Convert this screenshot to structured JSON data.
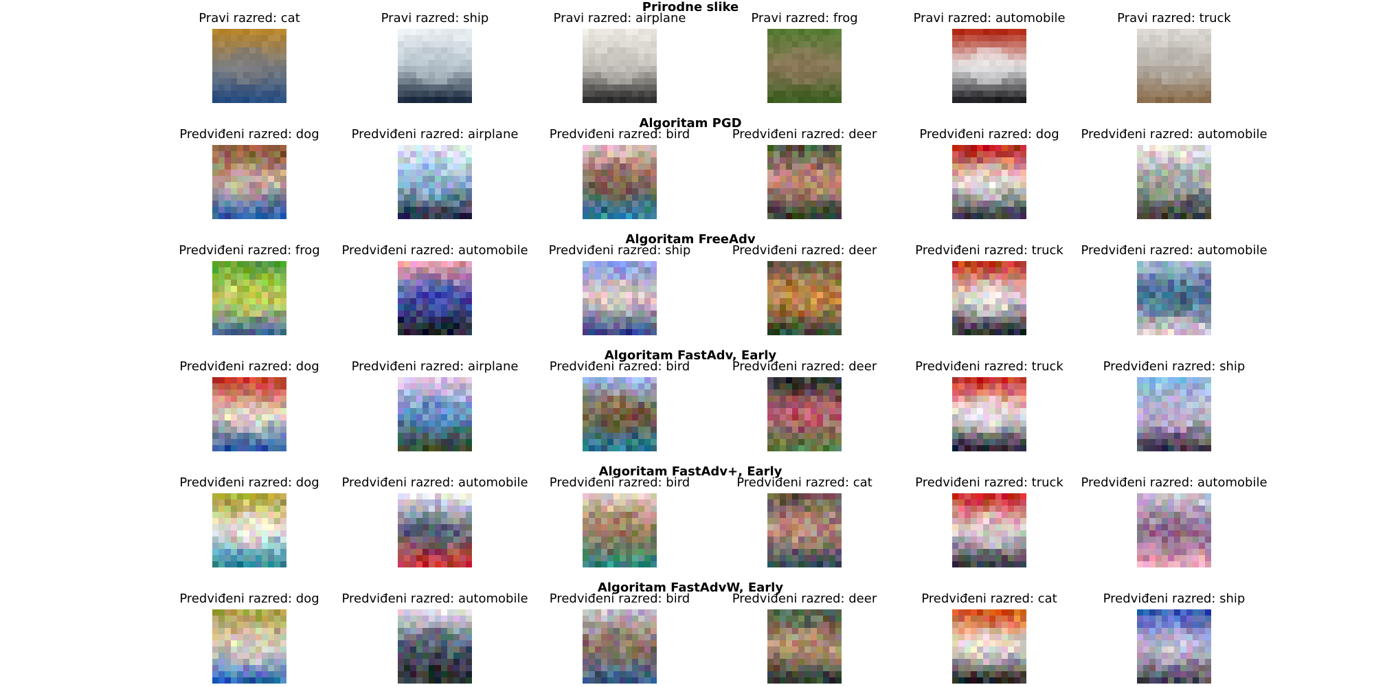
{
  "figure": {
    "rows": [
      {
        "title": "Prirodne slike",
        "labels": [
          "Pravi razred: cat",
          "Pravi razred: ship",
          "Pravi razred: airplane",
          "Pravi razred: frog",
          "Pravi razred: automobile",
          "Pravi razred: truck"
        ],
        "images": [
          {
            "subject": "cat",
            "colors": [
              "#b8862e",
              "#7d7d7f",
              "#2a4f82"
            ]
          },
          {
            "subject": "ship",
            "colors": [
              "#e8eef2",
              "#b8c4cc",
              "#1d2c40"
            ]
          },
          {
            "subject": "airplane",
            "colors": [
              "#eae6e0",
              "#c5c1bb",
              "#2e2e2e"
            ]
          },
          {
            "subject": "frog",
            "colors": [
              "#567a33",
              "#8c7859",
              "#3f5e22"
            ]
          },
          {
            "subject": "automobile",
            "colors": [
              "#b32a17",
              "#e8e8ea",
              "#1e1e22"
            ]
          },
          {
            "subject": "truck",
            "colors": [
              "#d9d5d0",
              "#b8b2aa",
              "#8a6d4e"
            ]
          }
        ]
      },
      {
        "title": "Algoritam PGD",
        "labels": [
          "Predviđeni razred: dog",
          "Predviđeni razred: airplane",
          "Predviđeni razred: bird",
          "Predviđeni razred: deer",
          "Predviđeni razred: dog",
          "Predviđeni razred: automobile"
        ],
        "images": [
          {
            "subject": "dog",
            "colors": [
              "#8c5a3c",
              "#c9b09c",
              "#2f5fa8"
            ]
          },
          {
            "subject": "airplane",
            "colors": [
              "#e4eaf6",
              "#8ab2d8",
              "#2f3346"
            ]
          },
          {
            "subject": "bird",
            "colors": [
              "#d9b8b8",
              "#7f5f4a",
              "#2e7f9a"
            ]
          },
          {
            "subject": "deer",
            "colors": [
              "#4f5d43",
              "#c9917f",
              "#2e3a2a"
            ]
          },
          {
            "subject": "dog",
            "colors": [
              "#b82a1e",
              "#e3d8d0",
              "#3a3a4a"
            ]
          },
          {
            "subject": "automobile",
            "colors": [
              "#e6e2e8",
              "#9ea6a0",
              "#3b3b3b"
            ]
          }
        ]
      },
      {
        "title": "Algoritam FreeAdv",
        "labels": [
          "Predviđeni razred: frog",
          "Predviđeni razred: automobile",
          "Predviđeni razred: ship",
          "Predviđeni razred: deer",
          "Predviđeni razred: truck",
          "Predviđeni razred: automobile"
        ],
        "images": [
          {
            "subject": "frog",
            "colors": [
              "#5fa83a",
              "#c4d25a",
              "#4f6a9a"
            ]
          },
          {
            "subject": "automobile",
            "colors": [
              "#e2a0b0",
              "#3f4fa8",
              "#1e2030"
            ]
          },
          {
            "subject": "ship",
            "colors": [
              "#8aa0e0",
              "#d8c8c0",
              "#3f4f8a"
            ]
          },
          {
            "subject": "deer",
            "colors": [
              "#6a5a4a",
              "#c98a4a",
              "#3b4a3a"
            ]
          },
          {
            "subject": "truck",
            "colors": [
              "#c43a2a",
              "#e8e2e0",
              "#2a2a3a"
            ]
          },
          {
            "subject": "automobile",
            "colors": [
              "#9ab0c8",
              "#3f6a8a",
              "#d8c4cf"
            ]
          }
        ]
      },
      {
        "title": "Algoritam FastAdv, Early",
        "labels": [
          "Predviđeni razred: dog",
          "Predviđeni razred: airplane",
          "Predviđeni razred: bird",
          "Predviđeni razred: deer",
          "Predviđeni razred: truck",
          "Predviđeni razred: ship"
        ],
        "images": [
          {
            "subject": "dog",
            "colors": [
              "#c83a2a",
              "#e8d8c8",
              "#2f5fa0"
            ]
          },
          {
            "subject": "airplane",
            "colors": [
              "#e6c8e8",
              "#5f8ac8",
              "#2f4a2a"
            ]
          },
          {
            "subject": "bird",
            "colors": [
              "#9ab0e0",
              "#7a5f3a",
              "#2f7a9a"
            ]
          },
          {
            "subject": "deer",
            "colors": [
              "#2f3a34",
              "#b85a6a",
              "#5a7a4a"
            ]
          },
          {
            "subject": "truck",
            "colors": [
              "#c8302a",
              "#ece6e6",
              "#2a2a38"
            ]
          },
          {
            "subject": "ship",
            "colors": [
              "#8ab8e0",
              "#c8b8d8",
              "#3f3a4a"
            ]
          }
        ]
      },
      {
        "title": "Algoritam FastAdv+, Early",
        "labels": [
          "Predviđeni razred: dog",
          "Predviđeni razred: automobile",
          "Predviđeni razred: bird",
          "Predviđeni razred: cat",
          "Predviđeni razred: truck",
          "Predviđeni razred: automobile"
        ],
        "images": [
          {
            "subject": "dog",
            "colors": [
              "#b0a83a",
              "#e8e0d8",
              "#2f8aa8"
            ]
          },
          {
            "subject": "automobile",
            "colors": [
              "#e8e2ec",
              "#5a6a7a",
              "#c83a3a"
            ]
          },
          {
            "subject": "bird",
            "colors": [
              "#d8c8b8",
              "#9a7a5a",
              "#3a8a7a"
            ]
          },
          {
            "subject": "cat",
            "colors": [
              "#6a5a50",
              "#b8907a",
              "#3a4a5a"
            ]
          },
          {
            "subject": "truck",
            "colors": [
              "#c8302a",
              "#e0d8d4",
              "#3a3a48"
            ]
          },
          {
            "subject": "automobile",
            "colors": [
              "#c8c0d8",
              "#8a6a8a",
              "#e8a0b8"
            ]
          }
        ]
      },
      {
        "title": "Algoritam FastAdvW, Early",
        "labels": [
          "Predviđeni razred: dog",
          "Predviđeni razred: automobile",
          "Predviđeni razred: bird",
          "Predviđeni razred: deer",
          "Predviđeni razred: cat",
          "Predviđeni razred: ship"
        ],
        "images": [
          {
            "subject": "dog",
            "colors": [
              "#a8a04a",
              "#e0d0c0",
              "#2f6ab8"
            ]
          },
          {
            "subject": "automobile",
            "colors": [
              "#e2dae8",
              "#4a5a6a",
              "#2a2a30"
            ]
          },
          {
            "subject": "bird",
            "colors": [
              "#c8b8c8",
              "#8a7060",
              "#3a5a8a"
            ]
          },
          {
            "subject": "deer",
            "colors": [
              "#4a5a4a",
              "#b89070",
              "#2f3a30"
            ]
          },
          {
            "subject": "cat",
            "colors": [
              "#d85a1a",
              "#e8e0dc",
              "#2a2a2e"
            ]
          },
          {
            "subject": "ship",
            "colors": [
              "#3a5ab8",
              "#c8c0d8",
              "#4a4a5a"
            ]
          }
        ]
      }
    ]
  }
}
